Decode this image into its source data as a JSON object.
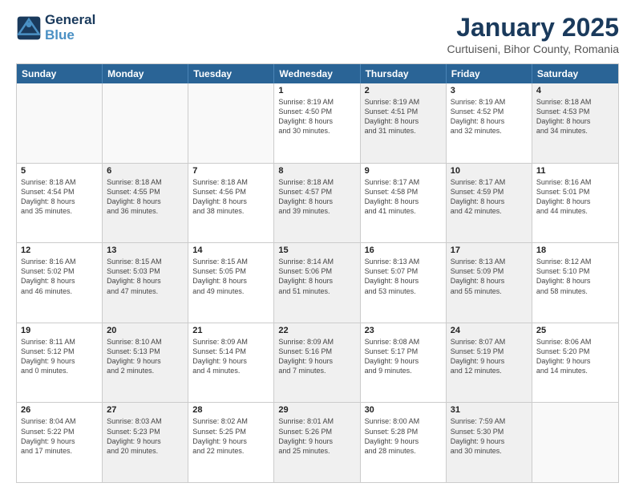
{
  "header": {
    "logo_line1": "General",
    "logo_line2": "Blue",
    "title": "January 2025",
    "subtitle": "Curtuiseni, Bihor County, Romania"
  },
  "weekdays": [
    "Sunday",
    "Monday",
    "Tuesday",
    "Wednesday",
    "Thursday",
    "Friday",
    "Saturday"
  ],
  "rows": [
    [
      {
        "day": "",
        "info": "",
        "shaded": false,
        "empty": true
      },
      {
        "day": "",
        "info": "",
        "shaded": false,
        "empty": true
      },
      {
        "day": "",
        "info": "",
        "shaded": false,
        "empty": true
      },
      {
        "day": "1",
        "info": "Sunrise: 8:19 AM\nSunset: 4:50 PM\nDaylight: 8 hours\nand 30 minutes.",
        "shaded": false,
        "empty": false
      },
      {
        "day": "2",
        "info": "Sunrise: 8:19 AM\nSunset: 4:51 PM\nDaylight: 8 hours\nand 31 minutes.",
        "shaded": true,
        "empty": false
      },
      {
        "day": "3",
        "info": "Sunrise: 8:19 AM\nSunset: 4:52 PM\nDaylight: 8 hours\nand 32 minutes.",
        "shaded": false,
        "empty": false
      },
      {
        "day": "4",
        "info": "Sunrise: 8:18 AM\nSunset: 4:53 PM\nDaylight: 8 hours\nand 34 minutes.",
        "shaded": true,
        "empty": false
      }
    ],
    [
      {
        "day": "5",
        "info": "Sunrise: 8:18 AM\nSunset: 4:54 PM\nDaylight: 8 hours\nand 35 minutes.",
        "shaded": false,
        "empty": false
      },
      {
        "day": "6",
        "info": "Sunrise: 8:18 AM\nSunset: 4:55 PM\nDaylight: 8 hours\nand 36 minutes.",
        "shaded": true,
        "empty": false
      },
      {
        "day": "7",
        "info": "Sunrise: 8:18 AM\nSunset: 4:56 PM\nDaylight: 8 hours\nand 38 minutes.",
        "shaded": false,
        "empty": false
      },
      {
        "day": "8",
        "info": "Sunrise: 8:18 AM\nSunset: 4:57 PM\nDaylight: 8 hours\nand 39 minutes.",
        "shaded": true,
        "empty": false
      },
      {
        "day": "9",
        "info": "Sunrise: 8:17 AM\nSunset: 4:58 PM\nDaylight: 8 hours\nand 41 minutes.",
        "shaded": false,
        "empty": false
      },
      {
        "day": "10",
        "info": "Sunrise: 8:17 AM\nSunset: 4:59 PM\nDaylight: 8 hours\nand 42 minutes.",
        "shaded": true,
        "empty": false
      },
      {
        "day": "11",
        "info": "Sunrise: 8:16 AM\nSunset: 5:01 PM\nDaylight: 8 hours\nand 44 minutes.",
        "shaded": false,
        "empty": false
      }
    ],
    [
      {
        "day": "12",
        "info": "Sunrise: 8:16 AM\nSunset: 5:02 PM\nDaylight: 8 hours\nand 46 minutes.",
        "shaded": false,
        "empty": false
      },
      {
        "day": "13",
        "info": "Sunrise: 8:15 AM\nSunset: 5:03 PM\nDaylight: 8 hours\nand 47 minutes.",
        "shaded": true,
        "empty": false
      },
      {
        "day": "14",
        "info": "Sunrise: 8:15 AM\nSunset: 5:05 PM\nDaylight: 8 hours\nand 49 minutes.",
        "shaded": false,
        "empty": false
      },
      {
        "day": "15",
        "info": "Sunrise: 8:14 AM\nSunset: 5:06 PM\nDaylight: 8 hours\nand 51 minutes.",
        "shaded": true,
        "empty": false
      },
      {
        "day": "16",
        "info": "Sunrise: 8:13 AM\nSunset: 5:07 PM\nDaylight: 8 hours\nand 53 minutes.",
        "shaded": false,
        "empty": false
      },
      {
        "day": "17",
        "info": "Sunrise: 8:13 AM\nSunset: 5:09 PM\nDaylight: 8 hours\nand 55 minutes.",
        "shaded": true,
        "empty": false
      },
      {
        "day": "18",
        "info": "Sunrise: 8:12 AM\nSunset: 5:10 PM\nDaylight: 8 hours\nand 58 minutes.",
        "shaded": false,
        "empty": false
      }
    ],
    [
      {
        "day": "19",
        "info": "Sunrise: 8:11 AM\nSunset: 5:12 PM\nDaylight: 9 hours\nand 0 minutes.",
        "shaded": false,
        "empty": false
      },
      {
        "day": "20",
        "info": "Sunrise: 8:10 AM\nSunset: 5:13 PM\nDaylight: 9 hours\nand 2 minutes.",
        "shaded": true,
        "empty": false
      },
      {
        "day": "21",
        "info": "Sunrise: 8:09 AM\nSunset: 5:14 PM\nDaylight: 9 hours\nand 4 minutes.",
        "shaded": false,
        "empty": false
      },
      {
        "day": "22",
        "info": "Sunrise: 8:09 AM\nSunset: 5:16 PM\nDaylight: 9 hours\nand 7 minutes.",
        "shaded": true,
        "empty": false
      },
      {
        "day": "23",
        "info": "Sunrise: 8:08 AM\nSunset: 5:17 PM\nDaylight: 9 hours\nand 9 minutes.",
        "shaded": false,
        "empty": false
      },
      {
        "day": "24",
        "info": "Sunrise: 8:07 AM\nSunset: 5:19 PM\nDaylight: 9 hours\nand 12 minutes.",
        "shaded": true,
        "empty": false
      },
      {
        "day": "25",
        "info": "Sunrise: 8:06 AM\nSunset: 5:20 PM\nDaylight: 9 hours\nand 14 minutes.",
        "shaded": false,
        "empty": false
      }
    ],
    [
      {
        "day": "26",
        "info": "Sunrise: 8:04 AM\nSunset: 5:22 PM\nDaylight: 9 hours\nand 17 minutes.",
        "shaded": false,
        "empty": false
      },
      {
        "day": "27",
        "info": "Sunrise: 8:03 AM\nSunset: 5:23 PM\nDaylight: 9 hours\nand 20 minutes.",
        "shaded": true,
        "empty": false
      },
      {
        "day": "28",
        "info": "Sunrise: 8:02 AM\nSunset: 5:25 PM\nDaylight: 9 hours\nand 22 minutes.",
        "shaded": false,
        "empty": false
      },
      {
        "day": "29",
        "info": "Sunrise: 8:01 AM\nSunset: 5:26 PM\nDaylight: 9 hours\nand 25 minutes.",
        "shaded": true,
        "empty": false
      },
      {
        "day": "30",
        "info": "Sunrise: 8:00 AM\nSunset: 5:28 PM\nDaylight: 9 hours\nand 28 minutes.",
        "shaded": false,
        "empty": false
      },
      {
        "day": "31",
        "info": "Sunrise: 7:59 AM\nSunset: 5:30 PM\nDaylight: 9 hours\nand 30 minutes.",
        "shaded": true,
        "empty": false
      },
      {
        "day": "",
        "info": "",
        "shaded": false,
        "empty": true
      }
    ]
  ]
}
